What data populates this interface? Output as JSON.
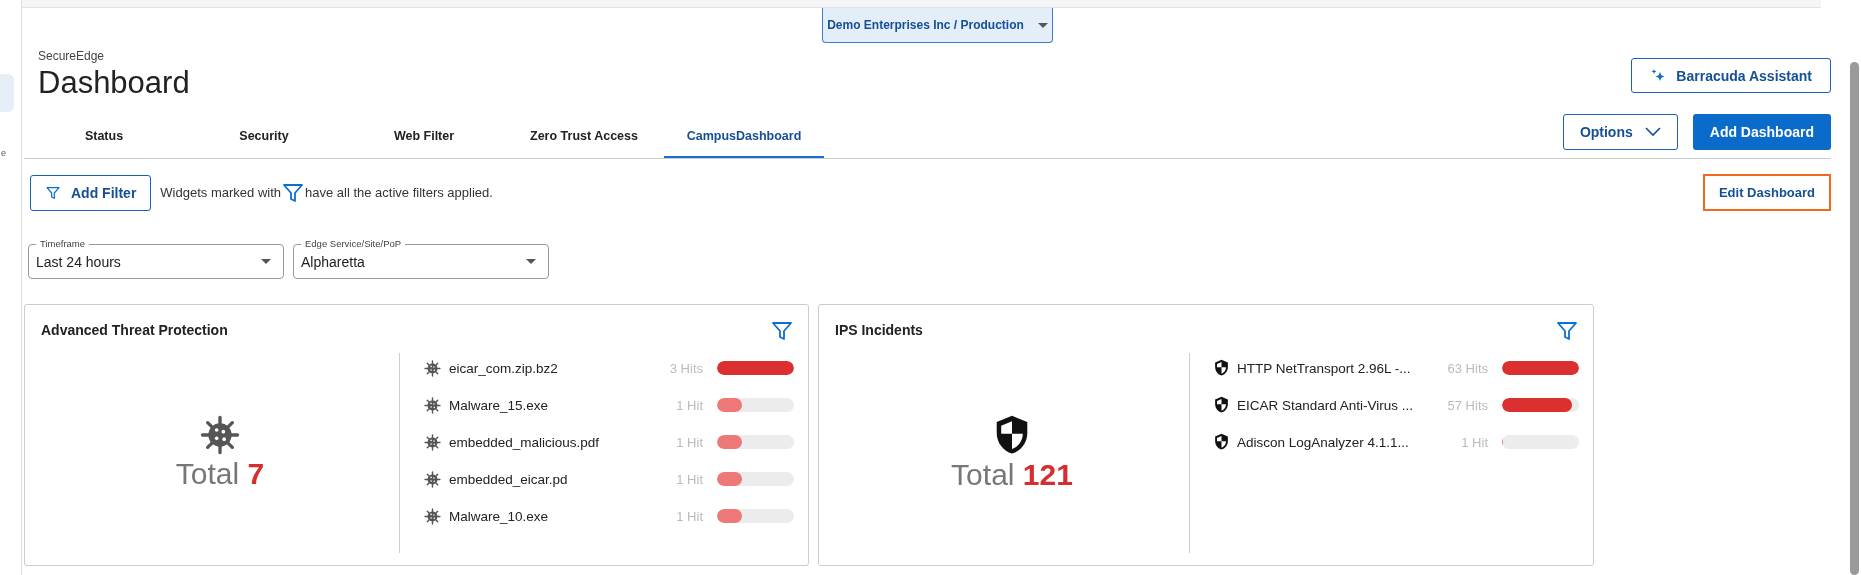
{
  "sidebar": {
    "fragment": "e"
  },
  "tenant_selector": {
    "value": "Demo Enterprises Inc / Production"
  },
  "header": {
    "product": "SecureEdge",
    "title": "Dashboard",
    "assistant_button": "Barracuda Assistant"
  },
  "tabs": [
    {
      "label": "Status",
      "selected": false
    },
    {
      "label": "Security",
      "selected": false
    },
    {
      "label": "Web Filter",
      "selected": false
    },
    {
      "label": "Zero Trust Access",
      "selected": false
    },
    {
      "label": "CampusDashboard",
      "selected": true
    }
  ],
  "toolbar": {
    "options_button": "Options",
    "add_dashboard_button": "Add Dashboard",
    "add_filter_button": "Add Filter",
    "filter_note_before": "Widgets marked with",
    "filter_note_after": "have all the active filters applied.",
    "edit_dashboard_button": "Edit Dashboard"
  },
  "filters": [
    {
      "label": "Timeframe",
      "value": "Last 24 hours"
    },
    {
      "label": "Edge Service/Site/PoP",
      "value": "Alpharetta"
    }
  ],
  "widgets": [
    {
      "title": "Advanced Threat Protection",
      "kind": "virus",
      "total_label": "Total",
      "total": "7",
      "items": [
        {
          "name": "eicar_com.zip.bz2",
          "hits": "3 Hits",
          "level": 1.0
        },
        {
          "name": "Malware_15.exe",
          "hits": "1 Hit",
          "level": 0.33
        },
        {
          "name": "embedded_malicious.pdf",
          "hits": "1 Hit",
          "level": 0.33
        },
        {
          "name": "embedded_eicar.pd",
          "hits": "1 Hit",
          "level": 0.33
        },
        {
          "name": "Malware_10.exe",
          "hits": "1 Hit",
          "level": 0.33
        }
      ]
    },
    {
      "title": "IPS Incidents",
      "kind": "shield",
      "total_label": "Total",
      "total": "121",
      "items": [
        {
          "name": "HTTP NetTransport 2.96L -...",
          "hits": "63 Hits",
          "level": 1.0
        },
        {
          "name": "EICAR Standard Anti-Virus ...",
          "hits": "57 Hits",
          "level": 0.905
        },
        {
          "name": "Adiscon LogAnalyzer 4.1.1...",
          "hits": "1 Hit",
          "level": 0.016
        }
      ]
    }
  ]
}
